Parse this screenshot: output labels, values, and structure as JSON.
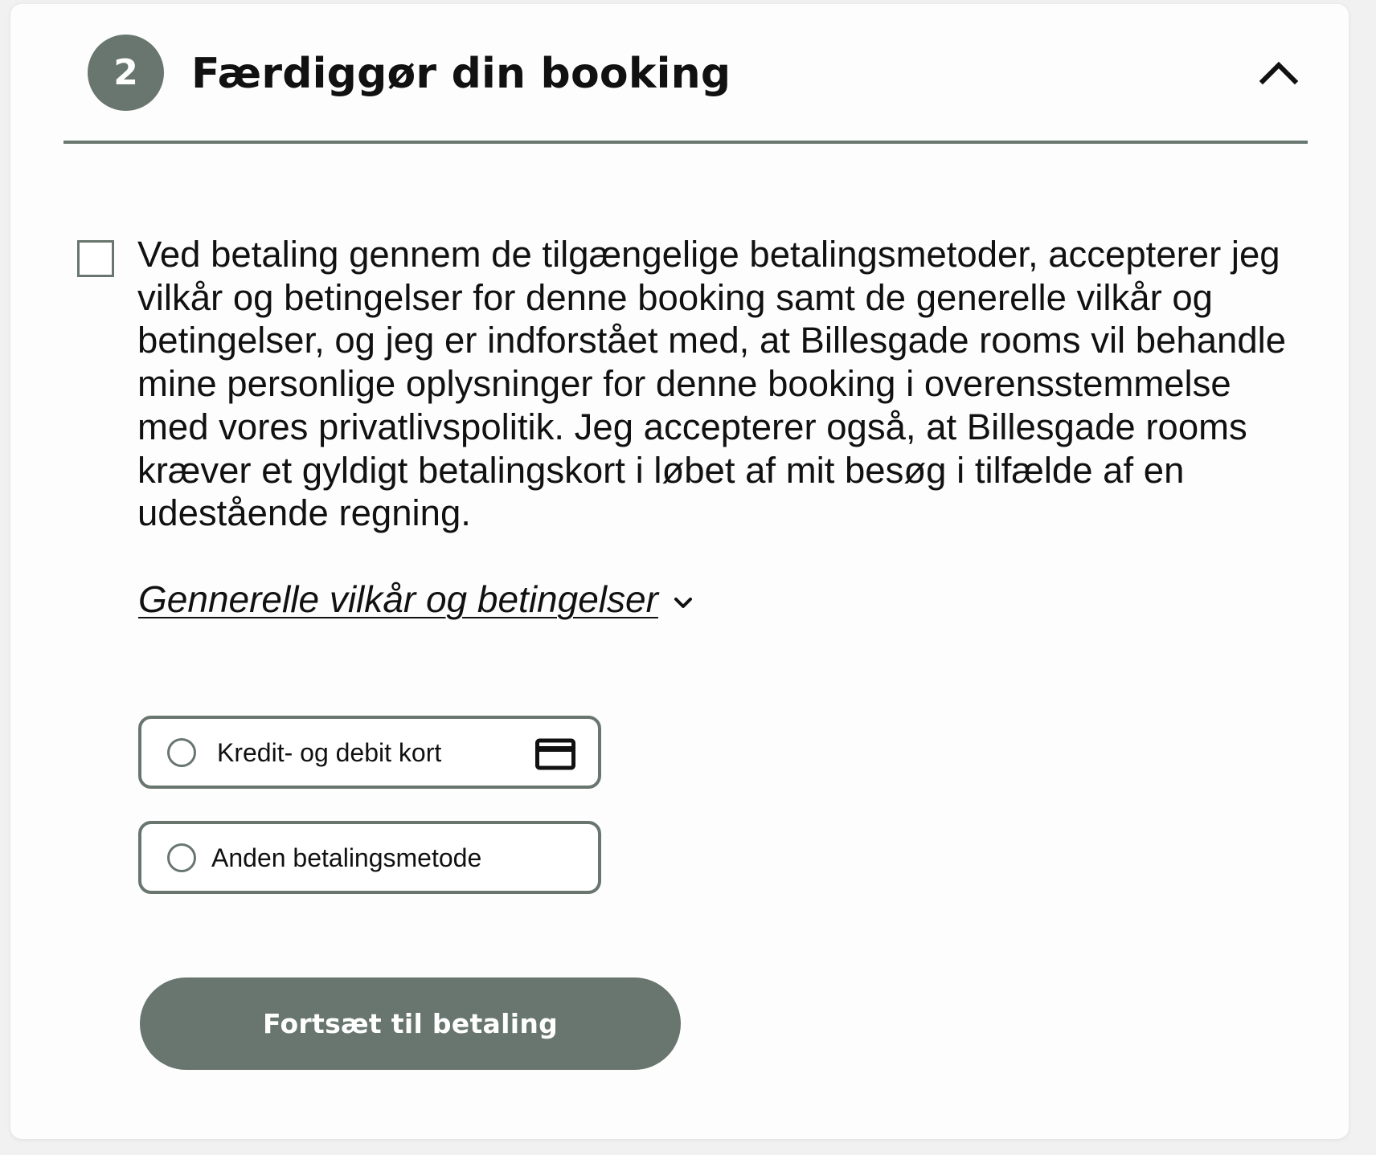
{
  "header": {
    "step_number": "2",
    "title": "Færdiggør din booking",
    "collapse_icon": "chevron-up-icon"
  },
  "consent": {
    "checked": false,
    "text": "Ved betaling gennem de tilgængelige betalingsmetoder, accepterer jeg vilkår og betingelser for denne booking samt de generelle vilkår og betingelser, og jeg er indforstået med, at Billesgade rooms vil behandle mine personlige oplysninger for denne booking i overensstemmelse med vores privatlivspolitik. Jeg accepterer også, at Billesgade rooms kræver et gyldigt betalingskort i løbet af mit besøg i tilfælde af en udestående regning."
  },
  "terms_link": {
    "label": "Gennerelle vilkår og betingelser",
    "icon": "chevron-down-icon"
  },
  "payment_options": [
    {
      "label": "Kredit- og debit kort",
      "selected": false,
      "icon": "credit-card-icon"
    },
    {
      "label": "Anden betalingsmetode",
      "selected": false
    }
  ],
  "continue_button": {
    "label": "Fortsæt til betaling"
  },
  "colors": {
    "accent": "#68766f",
    "text": "#111111",
    "card_background": "#fdfdfd",
    "page_background": "#f1f1f1"
  }
}
